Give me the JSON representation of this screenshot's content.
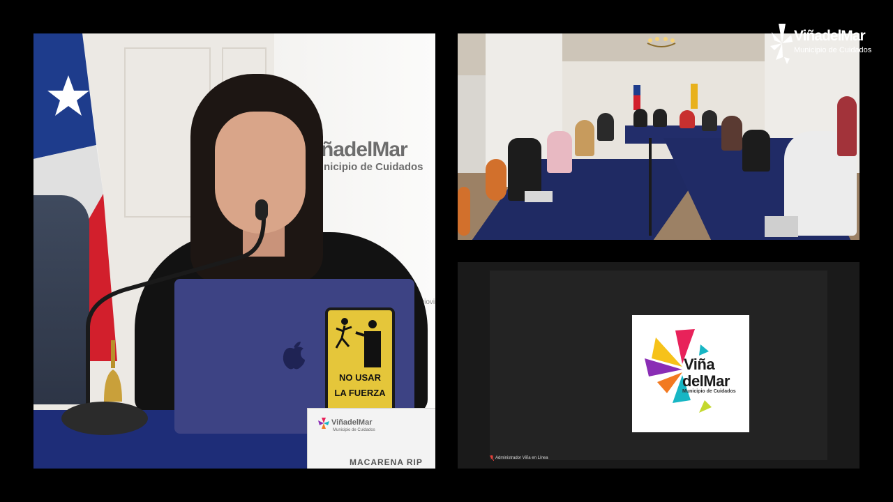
{
  "watermark": {
    "brand": "ViñadelMar",
    "subtitle": "Municipio de Cuidados",
    "icon": "vina-del-mar-flower-logo"
  },
  "speaker_tile": {
    "backdrop_brand": "ñadelMar",
    "backdrop_subtitle": "nicipio de Cuidados",
    "backdrop_handle": "@viovina",
    "sticker_line1": "NO USAR",
    "sticker_line2": "LA FUERZA",
    "nameplate_brand": "ViñadelMar",
    "nameplate_subtitle": "Municipio de Cuidados",
    "nameplate_name": "MACARENA RIP",
    "flag_colors": {
      "blue": "#1e3c8c",
      "white": "#f4f4f4",
      "red": "#d21f2c"
    }
  },
  "room_tile": {
    "scene": "council-room"
  },
  "participant_tile": {
    "logo_line1": "Viña",
    "logo_line2": "delMar",
    "logo_subtitle": "Municipio de Cuidados",
    "label": "Administrador Viña en Línea",
    "mic_status_icon": "mic-off-icon"
  },
  "colors": {
    "background": "#000000",
    "participant_tile_bg": "#1a1a1a",
    "logo_pink": "#e8225a",
    "logo_yellow": "#f6c21a",
    "logo_purple": "#8a2db5",
    "logo_orange": "#f27a21",
    "logo_teal": "#17b6c4",
    "logo_green": "#c4d82e"
  }
}
